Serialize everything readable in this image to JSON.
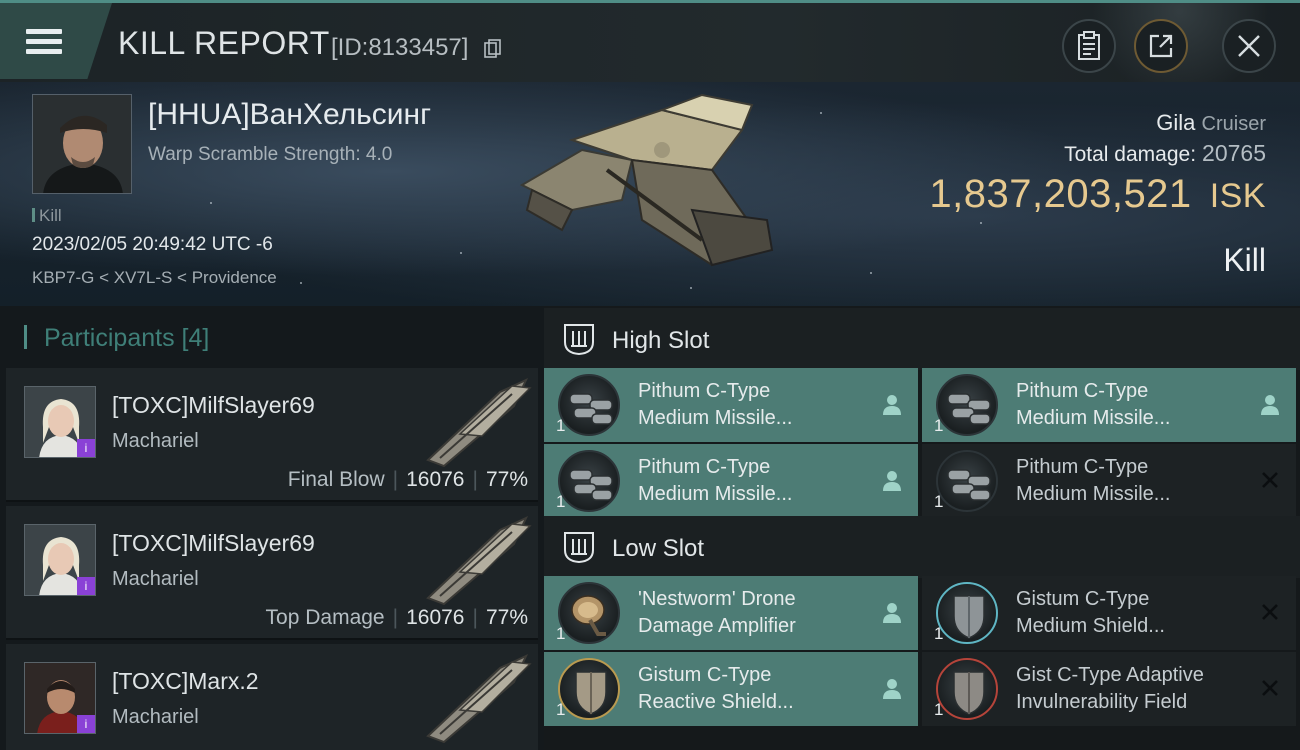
{
  "header": {
    "title": "KILL REPORT",
    "report_id": "[ID:8133457]"
  },
  "victim": {
    "name": "[HHUA]ВанХельсинг",
    "warp_scramble": "Warp Scramble Strength: 4.0",
    "kill_tag": "Kill",
    "datetime": "2023/02/05 20:49:42 UTC -6",
    "location": "KBP7-G < XV7L-S < Providence",
    "ship_name": "Gila",
    "ship_class": "Cruiser",
    "total_damage_label": "Total damage:",
    "total_damage": "20765",
    "isk_value": "1,837,203,521",
    "isk_unit": "ISK",
    "kill_type": "Kill"
  },
  "participants": {
    "label": "Participants",
    "count": "[4]",
    "items": [
      {
        "name": "[TOXC]MilfSlayer69",
        "ship": "Machariel",
        "role": "Final Blow",
        "damage": "16076",
        "percent": "77%",
        "badge": "i"
      },
      {
        "name": "[TOXC]MilfSlayer69",
        "ship": "Machariel",
        "role": "Top Damage",
        "damage": "16076",
        "percent": "77%",
        "badge": "i"
      },
      {
        "name": "[TOXC]Marx.2",
        "ship": "Machariel",
        "role": "",
        "damage": "",
        "percent": "",
        "badge": "i"
      }
    ]
  },
  "slots": {
    "high": {
      "title": "High Slot",
      "modules": [
        {
          "line1": "Pithum C-Type",
          "line2": "Medium Missile...",
          "qty": "1",
          "status": "fitted"
        },
        {
          "line1": "Pithum C-Type",
          "line2": "Medium Missile...",
          "qty": "1",
          "status": "fitted"
        },
        {
          "line1": "Pithum C-Type",
          "line2": "Medium Missile...",
          "qty": "1",
          "status": "fitted"
        },
        {
          "line1": "Pithum C-Type",
          "line2": "Medium Missile...",
          "qty": "1",
          "status": "destroyed"
        }
      ]
    },
    "low": {
      "title": "Low Slot",
      "modules": [
        {
          "line1": "'Nestworm' Drone",
          "line2": "Damage Amplifier",
          "qty": "1",
          "status": "fitted"
        },
        {
          "line1": "Gistum C-Type",
          "line2": "Medium Shield...",
          "qty": "1",
          "status": "destroyed"
        },
        {
          "line1": "Gistum C-Type",
          "line2": "Reactive Shield...",
          "qty": "1",
          "status": "fitted"
        },
        {
          "line1": "Gist C-Type Adaptive",
          "line2": "Invulnerability Field",
          "qty": "1",
          "status": "destroyed"
        }
      ]
    }
  },
  "colors": {
    "accent": "#4f8d86",
    "fitted_bg": "#4d7c75",
    "isk_gold": "#e6c98f",
    "badge_purple": "#8a41d6"
  },
  "icons": {
    "menu": "hamburger-icon",
    "copy": "copy-icon",
    "clipboard": "clipboard-icon",
    "share": "share-icon",
    "close": "close-icon",
    "slot_header": "slot-icon",
    "fitted": "person-icon",
    "destroyed": "x-icon"
  }
}
